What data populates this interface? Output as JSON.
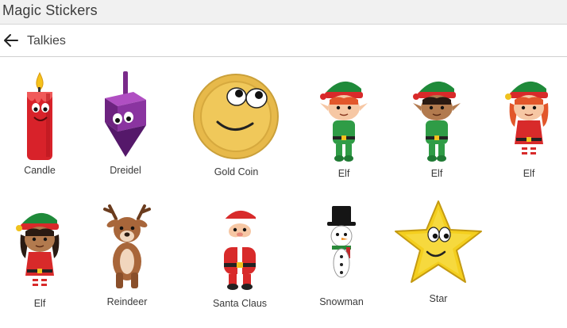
{
  "app": {
    "title": "Magic Stickers"
  },
  "header": {
    "section_title": "Talkies"
  },
  "stickers": [
    {
      "label": "Candle",
      "icon": "candle-icon"
    },
    {
      "label": "Dreidel",
      "icon": "dreidel-icon"
    },
    {
      "label": "Gold Coin",
      "icon": "gold-coin-icon"
    },
    {
      "label": "Elf",
      "icon": "elf-icon"
    },
    {
      "label": "Elf",
      "icon": "elf-icon"
    },
    {
      "label": "Elf",
      "icon": "elf-icon"
    },
    {
      "label": "Elf",
      "icon": "elf-icon"
    },
    {
      "label": "Reindeer",
      "icon": "reindeer-icon"
    },
    {
      "label": "Santa Claus",
      "icon": "santa-claus-icon"
    },
    {
      "label": "Snowman",
      "icon": "snowman-icon"
    },
    {
      "label": "Star",
      "icon": "star-icon"
    }
  ]
}
